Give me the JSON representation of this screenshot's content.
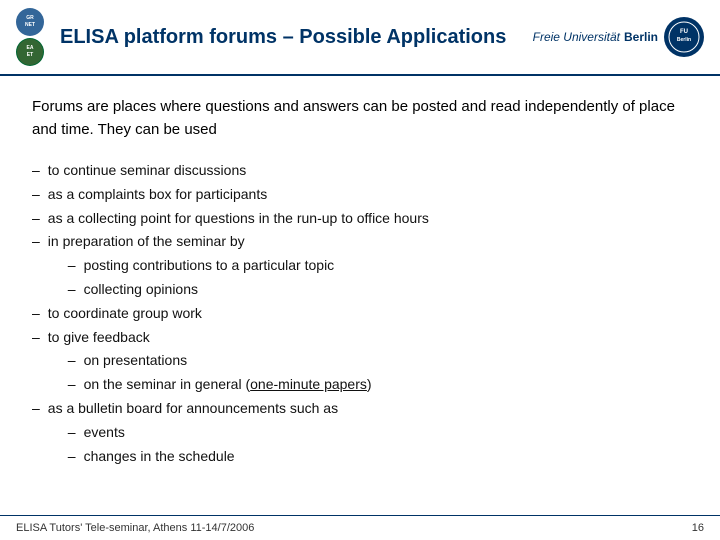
{
  "header": {
    "title": "ELISA platform forums – Possible Applications",
    "fu_text": "Freie Universität",
    "berlin_text": "Berlin",
    "grnet_label": "GRNET",
    "eaet_label": "EAET"
  },
  "content": {
    "intro": "Forums are places where questions and answers can be posted and read independently of place and time. They can be used",
    "items": [
      {
        "text": "to continue seminar discussions"
      },
      {
        "text": "as a complaints box for participants"
      },
      {
        "text": "as a collecting point for questions in the run-up to office hours"
      },
      {
        "text": "in preparation of the seminar by",
        "subitems": [
          {
            "text": "posting contributions to a particular topic"
          },
          {
            "text": "collecting opinions"
          }
        ]
      },
      {
        "text": "to coordinate group work"
      },
      {
        "text": "to give feedback",
        "subitems": [
          {
            "text": "on presentations"
          },
          {
            "text": "on the seminar in general (",
            "link": "one-minute papers",
            "after": ")"
          }
        ]
      },
      {
        "text": "as a bulletin board for announcements such as",
        "subitems": [
          {
            "text": "events"
          },
          {
            "text": "changes in the schedule"
          }
        ]
      }
    ]
  },
  "footer": {
    "label": "ELISA Tutors' Tele-seminar, Athens 11-14/7/2006",
    "page": "16"
  }
}
